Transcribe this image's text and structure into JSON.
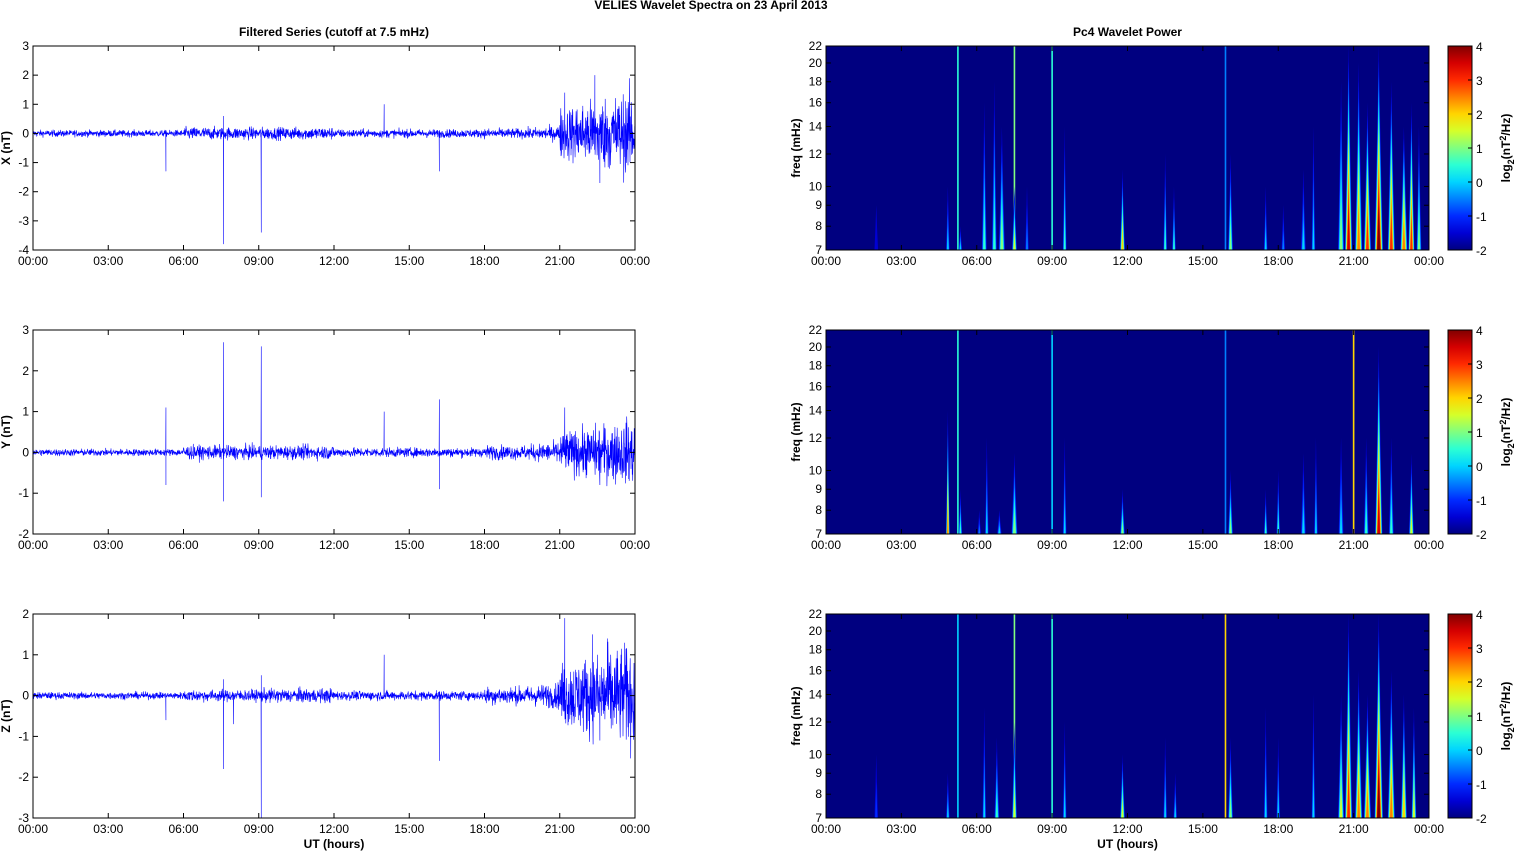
{
  "chart_data": {
    "type": "line+heatmap",
    "title": "VELIES Wavelet Spectra on 23 April     2013",
    "left_title": "Filtered Series (cutoff at 7.5 mHz)",
    "right_title": "Pc4 Wavelet Power",
    "xlabel": "UT (hours)",
    "xlim": [
      0,
      24
    ],
    "xticks": [
      "00:00",
      "03:00",
      "06:00",
      "09:00",
      "12:00",
      "15:00",
      "18:00",
      "21:00",
      "00:00"
    ],
    "freq_label": "freq (mHz)",
    "freq_lim": [
      7,
      22
    ],
    "freq_scale": "log",
    "freq_ticks": [
      "7",
      "8",
      "9",
      "10",
      "12",
      "14",
      "16",
      "18",
      "20",
      "22"
    ],
    "colorbar": {
      "lim": [
        -2,
        4
      ],
      "ticks": [
        "4",
        "3",
        "2",
        "1",
        "0",
        "-1",
        "-2"
      ],
      "colormap": "jet",
      "label": {
        "base": "log",
        "sub": "2",
        "mid": "(nT",
        "sup": "2",
        "end": "/Hz)"
      }
    },
    "line_color": "#0000ff",
    "panels": [
      {
        "ylabel": "X (nT)",
        "ylim": [
          -4,
          3
        ],
        "yticks": [
          "3",
          "2",
          "1",
          "0",
          "-1",
          "-2",
          "-3",
          "-4"
        ],
        "noise_by_3h": [
          0.08,
          0.08,
          0.15,
          0.15,
          0.1,
          0.1,
          0.12,
          0.4
        ],
        "spikes": [
          [
            5.3,
            -1.3
          ],
          [
            7.6,
            -3.8
          ],
          [
            7.6,
            0.6
          ],
          [
            9.1,
            -3.4
          ],
          [
            14.0,
            1.0
          ],
          [
            16.2,
            -1.3
          ],
          [
            21.2,
            1.4
          ],
          [
            22.4,
            2.0
          ],
          [
            22.6,
            -1.7
          ]
        ],
        "events": [
          [
            2.0,
            0.15,
            9,
            -1.5
          ],
          [
            4.85,
            0.15,
            10,
            0
          ],
          [
            5.25,
            0.04,
            22,
            0.5,
            "line"
          ],
          [
            5.35,
            0.15,
            8,
            0
          ],
          [
            6.3,
            0.2,
            16,
            0.5
          ],
          [
            6.7,
            0.2,
            18,
            0.5
          ],
          [
            7.0,
            0.25,
            14,
            1
          ],
          [
            7.5,
            0.04,
            22,
            1,
            "line"
          ],
          [
            7.5,
            0.2,
            10,
            1.5
          ],
          [
            8.0,
            0.15,
            10,
            -0.5
          ],
          [
            9.0,
            0.04,
            22,
            0.5,
            "line"
          ],
          [
            9.5,
            0.15,
            14,
            0.5
          ],
          [
            11.8,
            0.2,
            11,
            2
          ],
          [
            13.5,
            0.15,
            12,
            0.5
          ],
          [
            13.85,
            0.15,
            10,
            0.5
          ],
          [
            15.9,
            0.04,
            22,
            -0.5,
            "line"
          ],
          [
            16.1,
            0.2,
            12,
            1
          ],
          [
            17.5,
            0.15,
            10,
            0
          ],
          [
            18.2,
            0.15,
            9,
            -0.5
          ],
          [
            19.0,
            0.2,
            11,
            0
          ],
          [
            19.4,
            0.15,
            14,
            0
          ],
          [
            20.5,
            0.25,
            18,
            1
          ],
          [
            20.8,
            0.3,
            22,
            3.5
          ],
          [
            21.2,
            0.3,
            20,
            2.5
          ],
          [
            21.55,
            0.3,
            16,
            3
          ],
          [
            22.0,
            0.35,
            22,
            4
          ],
          [
            22.5,
            0.3,
            18,
            3
          ],
          [
            23.0,
            0.3,
            14,
            2.5
          ],
          [
            23.3,
            0.25,
            16,
            3
          ],
          [
            23.6,
            0.2,
            14,
            1
          ]
        ]
      },
      {
        "ylabel": "Y (nT)",
        "ylim": [
          -2,
          3
        ],
        "yticks": [
          "3",
          "2",
          "1",
          "0",
          "-1",
          "-2"
        ],
        "noise_by_3h": [
          0.06,
          0.06,
          0.12,
          0.12,
          0.08,
          0.08,
          0.12,
          0.22
        ],
        "spikes": [
          [
            5.3,
            1.1
          ],
          [
            5.3,
            -0.8
          ],
          [
            7.6,
            2.7
          ],
          [
            7.6,
            -1.2
          ],
          [
            9.1,
            2.6
          ],
          [
            9.1,
            -1.1
          ],
          [
            14.0,
            1.0
          ],
          [
            16.2,
            1.3
          ],
          [
            16.2,
            -0.9
          ],
          [
            21.2,
            1.1
          ],
          [
            22.6,
            -0.8
          ]
        ],
        "events": [
          [
            4.85,
            0.15,
            14,
            2.5
          ],
          [
            5.25,
            0.04,
            22,
            0.5,
            "line"
          ],
          [
            5.35,
            0.15,
            9,
            0.5
          ],
          [
            6.1,
            0.15,
            8,
            -0.5
          ],
          [
            6.4,
            0.15,
            12,
            0
          ],
          [
            6.9,
            0.2,
            8,
            0
          ],
          [
            7.5,
            0.25,
            11,
            1
          ],
          [
            9.0,
            0.04,
            22,
            0,
            "line"
          ],
          [
            9.5,
            0.15,
            12,
            0
          ],
          [
            11.8,
            0.2,
            9,
            1
          ],
          [
            15.9,
            0.04,
            22,
            -0.5,
            "line"
          ],
          [
            16.1,
            0.2,
            10,
            1
          ],
          [
            17.5,
            0.15,
            9,
            0.5
          ],
          [
            18.0,
            0.15,
            10,
            0.5
          ],
          [
            19.0,
            0.2,
            11,
            0
          ],
          [
            19.5,
            0.15,
            12,
            0
          ],
          [
            20.5,
            0.2,
            12,
            0
          ],
          [
            21.0,
            0.04,
            22,
            2,
            "line"
          ],
          [
            21.5,
            0.2,
            12,
            0.5
          ],
          [
            22.0,
            0.3,
            20,
            3.5
          ],
          [
            22.5,
            0.2,
            12,
            0.5
          ],
          [
            23.3,
            0.2,
            11,
            1.5
          ]
        ]
      },
      {
        "ylabel": "Z (nT)",
        "ylim": [
          -3,
          2
        ],
        "yticks": [
          "2",
          "1",
          "0",
          "-1",
          "-2",
          "-3"
        ],
        "noise_by_3h": [
          0.06,
          0.06,
          0.1,
          0.12,
          0.08,
          0.08,
          0.15,
          0.35
        ],
        "spikes": [
          [
            5.3,
            -0.6
          ],
          [
            7.6,
            -1.8
          ],
          [
            7.6,
            0.4
          ],
          [
            8.0,
            -0.7
          ],
          [
            9.1,
            -3.0
          ],
          [
            9.1,
            0.5
          ],
          [
            14.0,
            1.0
          ],
          [
            16.2,
            -1.6
          ],
          [
            21.2,
            1.9
          ],
          [
            22.3,
            1.5
          ],
          [
            22.6,
            -1.1
          ],
          [
            22.9,
            1.4
          ]
        ],
        "events": [
          [
            2.0,
            0.15,
            10,
            -1
          ],
          [
            4.85,
            0.15,
            9,
            0
          ],
          [
            5.25,
            0.04,
            22,
            0,
            "line"
          ],
          [
            6.3,
            0.15,
            13,
            0
          ],
          [
            6.8,
            0.2,
            11,
            0.5
          ],
          [
            7.5,
            0.04,
            22,
            1,
            "line"
          ],
          [
            7.5,
            0.2,
            12,
            1.5
          ],
          [
            9.0,
            0.04,
            22,
            0.5,
            "line"
          ],
          [
            9.5,
            0.15,
            12,
            0
          ],
          [
            11.8,
            0.2,
            10,
            1.5
          ],
          [
            13.5,
            0.15,
            11,
            0
          ],
          [
            13.9,
            0.15,
            9,
            0
          ],
          [
            15.9,
            0.04,
            22,
            2,
            "line"
          ],
          [
            16.1,
            0.2,
            11,
            1
          ],
          [
            17.5,
            0.15,
            13,
            0
          ],
          [
            18.0,
            0.15,
            11,
            0
          ],
          [
            19.4,
            0.15,
            14,
            0
          ],
          [
            20.5,
            0.25,
            14,
            1.5
          ],
          [
            20.8,
            0.3,
            22,
            3
          ],
          [
            21.2,
            0.3,
            16,
            2.5
          ],
          [
            21.55,
            0.3,
            14,
            2.5
          ],
          [
            22.0,
            0.35,
            22,
            4
          ],
          [
            22.5,
            0.3,
            16,
            2.5
          ],
          [
            23.0,
            0.25,
            14,
            2
          ],
          [
            23.4,
            0.2,
            13,
            1.5
          ]
        ]
      }
    ]
  }
}
